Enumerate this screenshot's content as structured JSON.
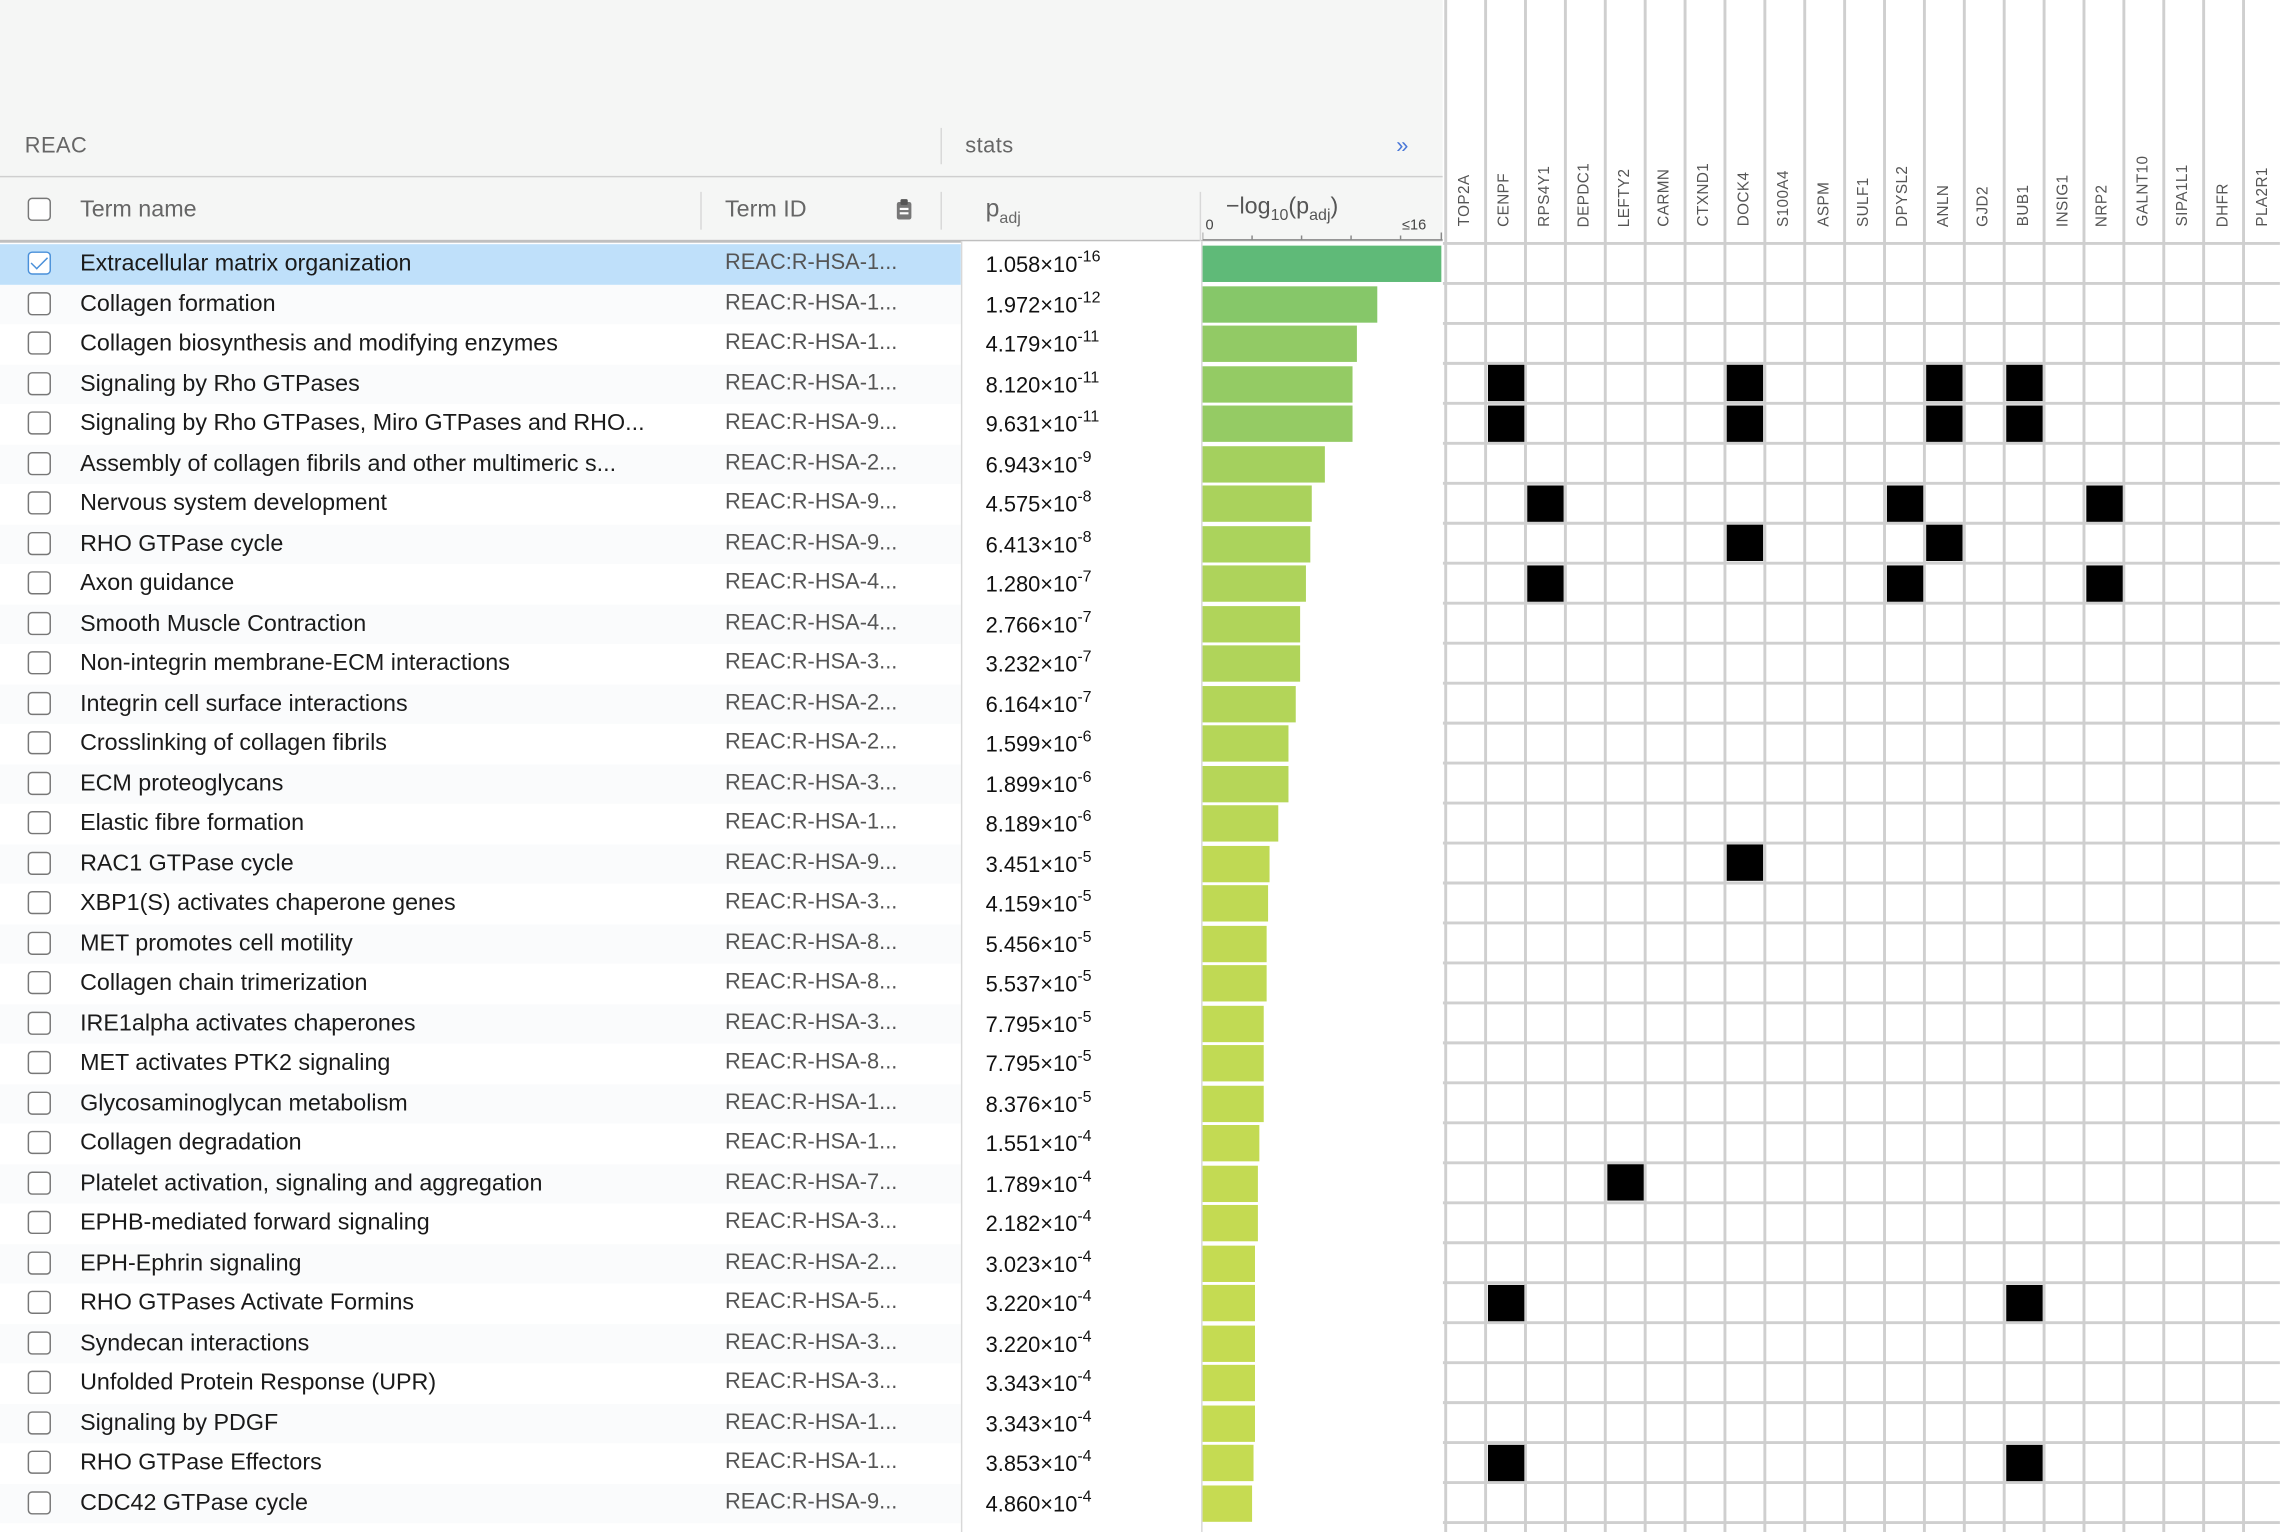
{
  "source": "REAC",
  "stats_label": "stats",
  "expand_glyph": "»",
  "columns": {
    "term_name": "Term name",
    "term_id": "Term ID",
    "padj": "p",
    "padj_sub": "adj",
    "log_prefix": "−log",
    "log_base": "10",
    "log_mid": "(p",
    "log_sub": "adj",
    "log_suffix": ")",
    "scale_min": "0",
    "scale_max": "≤16"
  },
  "genes": [
    "TOP2A",
    "CENPF",
    "RPS4Y1",
    "DEPDC1",
    "LEFTY2",
    "CARMN",
    "CTXND1",
    "DOCK4",
    "S100A4",
    "ASPM",
    "SULF1",
    "DPYSL2",
    "ANLN",
    "GJD2",
    "BUB1",
    "INSIG1",
    "NRP2",
    "GALNT10",
    "SIPA1L1",
    "DHFR",
    "PLA2R1"
  ],
  "rows": [
    {
      "name": "Extracellular matrix organization",
      "id": "REAC:R-HSA-1...",
      "mant": "1.058",
      "exp": "-16",
      "log": 15.98,
      "checked": true,
      "genes": []
    },
    {
      "name": "Collagen formation",
      "id": "REAC:R-HSA-1...",
      "mant": "1.972",
      "exp": "-12",
      "log": 11.71,
      "genes": []
    },
    {
      "name": "Collagen biosynthesis and modifying enzymes",
      "id": "REAC:R-HSA-1...",
      "mant": "4.179",
      "exp": "-11",
      "log": 10.38,
      "genes": []
    },
    {
      "name": "Signaling by Rho GTPases",
      "id": "REAC:R-HSA-1...",
      "mant": "8.120",
      "exp": "-11",
      "log": 10.09,
      "genes": [
        "CENPF",
        "DOCK4",
        "ANLN",
        "BUB1"
      ]
    },
    {
      "name": "Signaling by Rho GTPases, Miro GTPases and RHO...",
      "id": "REAC:R-HSA-9...",
      "mant": "9.631",
      "exp": "-11",
      "log": 10.02,
      "genes": [
        "CENPF",
        "DOCK4",
        "ANLN",
        "BUB1"
      ]
    },
    {
      "name": "Assembly of collagen fibrils and other multimeric s...",
      "id": "REAC:R-HSA-2...",
      "mant": "6.943",
      "exp": "-9",
      "log": 8.16,
      "genes": []
    },
    {
      "name": "Nervous system development",
      "id": "REAC:R-HSA-9...",
      "mant": "4.575",
      "exp": "-8",
      "log": 7.34,
      "genes": [
        "RPS4Y1",
        "DPYSL2",
        "NRP2"
      ]
    },
    {
      "name": "RHO GTPase cycle",
      "id": "REAC:R-HSA-9...",
      "mant": "6.413",
      "exp": "-8",
      "log": 7.19,
      "genes": [
        "DOCK4",
        "ANLN"
      ]
    },
    {
      "name": "Axon guidance",
      "id": "REAC:R-HSA-4...",
      "mant": "1.280",
      "exp": "-7",
      "log": 6.89,
      "genes": [
        "RPS4Y1",
        "DPYSL2",
        "NRP2"
      ]
    },
    {
      "name": "Smooth Muscle Contraction",
      "id": "REAC:R-HSA-4...",
      "mant": "2.766",
      "exp": "-7",
      "log": 6.56,
      "genes": []
    },
    {
      "name": "Non-integrin membrane-ECM interactions",
      "id": "REAC:R-HSA-3...",
      "mant": "3.232",
      "exp": "-7",
      "log": 6.49,
      "genes": []
    },
    {
      "name": "Integrin cell surface interactions",
      "id": "REAC:R-HSA-2...",
      "mant": "6.164",
      "exp": "-7",
      "log": 6.21,
      "genes": []
    },
    {
      "name": "Crosslinking of collagen fibrils",
      "id": "REAC:R-HSA-2...",
      "mant": "1.599",
      "exp": "-6",
      "log": 5.8,
      "genes": []
    },
    {
      "name": "ECM proteoglycans",
      "id": "REAC:R-HSA-3...",
      "mant": "1.899",
      "exp": "-6",
      "log": 5.72,
      "genes": []
    },
    {
      "name": "Elastic fibre formation",
      "id": "REAC:R-HSA-1...",
      "mant": "8.189",
      "exp": "-6",
      "log": 5.09,
      "genes": []
    },
    {
      "name": "RAC1 GTPase cycle",
      "id": "REAC:R-HSA-9...",
      "mant": "3.451",
      "exp": "-5",
      "log": 4.46,
      "genes": [
        "DOCK4"
      ]
    },
    {
      "name": "XBP1(S) activates chaperone genes",
      "id": "REAC:R-HSA-3...",
      "mant": "4.159",
      "exp": "-5",
      "log": 4.38,
      "genes": []
    },
    {
      "name": "MET promotes cell motility",
      "id": "REAC:R-HSA-8...",
      "mant": "5.456",
      "exp": "-5",
      "log": 4.26,
      "genes": []
    },
    {
      "name": "Collagen chain trimerization",
      "id": "REAC:R-HSA-8...",
      "mant": "5.537",
      "exp": "-5",
      "log": 4.26,
      "genes": []
    },
    {
      "name": "IRE1alpha activates chaperones",
      "id": "REAC:R-HSA-3...",
      "mant": "7.795",
      "exp": "-5",
      "log": 4.11,
      "genes": []
    },
    {
      "name": "MET activates PTK2 signaling",
      "id": "REAC:R-HSA-8...",
      "mant": "7.795",
      "exp": "-5",
      "log": 4.11,
      "genes": []
    },
    {
      "name": "Glycosaminoglycan metabolism",
      "id": "REAC:R-HSA-1...",
      "mant": "8.376",
      "exp": "-5",
      "log": 4.08,
      "genes": []
    },
    {
      "name": "Collagen degradation",
      "id": "REAC:R-HSA-1...",
      "mant": "1.551",
      "exp": "-4",
      "log": 3.81,
      "genes": []
    },
    {
      "name": "Platelet activation, signaling and aggregation",
      "id": "REAC:R-HSA-7...",
      "mant": "1.789",
      "exp": "-4",
      "log": 3.75,
      "genes": [
        "LEFTY2"
      ]
    },
    {
      "name": "EPHB-mediated forward signaling",
      "id": "REAC:R-HSA-3...",
      "mant": "2.182",
      "exp": "-4",
      "log": 3.66,
      "genes": []
    },
    {
      "name": "EPH-Ephrin signaling",
      "id": "REAC:R-HSA-2...",
      "mant": "3.023",
      "exp": "-4",
      "log": 3.52,
      "genes": []
    },
    {
      "name": "RHO GTPases Activate Formins",
      "id": "REAC:R-HSA-5...",
      "mant": "3.220",
      "exp": "-4",
      "log": 3.49,
      "genes": [
        "CENPF",
        "BUB1"
      ]
    },
    {
      "name": "Syndecan interactions",
      "id": "REAC:R-HSA-3...",
      "mant": "3.220",
      "exp": "-4",
      "log": 3.49,
      "genes": []
    },
    {
      "name": "Unfolded Protein Response (UPR)",
      "id": "REAC:R-HSA-3...",
      "mant": "3.343",
      "exp": "-4",
      "log": 3.48,
      "genes": []
    },
    {
      "name": "Signaling by PDGF",
      "id": "REAC:R-HSA-1...",
      "mant": "3.343",
      "exp": "-4",
      "log": 3.48,
      "genes": []
    },
    {
      "name": "RHO GTPase Effectors",
      "id": "REAC:R-HSA-1...",
      "mant": "3.853",
      "exp": "-4",
      "log": 3.41,
      "genes": [
        "CENPF",
        "BUB1"
      ]
    },
    {
      "name": "CDC42 GTPase cycle",
      "id": "REAC:R-HSA-9...",
      "mant": "4.860",
      "exp": "-4",
      "log": 3.31,
      "genes": []
    }
  ]
}
